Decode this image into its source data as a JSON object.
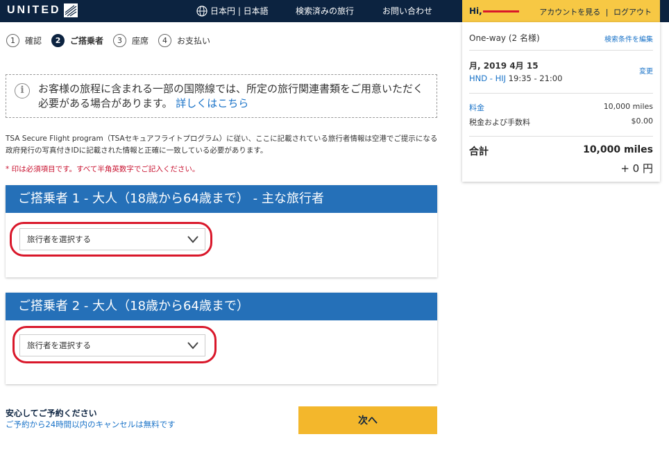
{
  "header": {
    "logo_text": "UNITED",
    "currency_language": "日本円 | 日本語",
    "searched_trips": "検索済みの旅行",
    "contact": "お問い合わせ"
  },
  "account": {
    "greeting": "Hi,",
    "view_account": "アカウントを見る",
    "separator": "|",
    "logout": "ログアウト"
  },
  "stepper": [
    {
      "num": "1",
      "label": "確認"
    },
    {
      "num": "2",
      "label": "ご搭乗者"
    },
    {
      "num": "3",
      "label": "座席"
    },
    {
      "num": "4",
      "label": "お支払い"
    }
  ],
  "notice": {
    "text": "お客様の旅程に含まれる一部の国際線では、所定の旅行関連書類をご用意いただく必要がある場合があります。",
    "link": "詳しくはこちら"
  },
  "tsa_text": "TSA Secure Flight program（TSAセキュアフライトプログラム）に従い、ここに記載されている旅行者情報は空港でご提示になる政府発行の写真付きIDに記載された情報と正確に一致している必要があります。",
  "required_note": "* 印は必須項目です。すべて半角英数字でご記入ください。",
  "passengers": [
    {
      "title": "ご搭乗者 1 - 大人（18歳から64歳まで） - 主な旅行者",
      "select_value": "旅行者を選択する"
    },
    {
      "title": "ご搭乗者 2 - 大人（18歳から64歳まで）",
      "select_value": "旅行者を選択する"
    }
  ],
  "assurance": {
    "title": "安心してご予約ください",
    "subtitle": "ご予約から24時間以内のキャンセルは無料です"
  },
  "next_button": "次へ",
  "summary": {
    "trip_type": "One-way (2 名様)",
    "edit_search": "検索条件を編集",
    "date": "月, 2019 4月 15",
    "change": "変更",
    "route_code": "HND - HIJ",
    "route_time": "19:35 - 21:00",
    "fare_label": "料金",
    "fare_value": "10,000 miles",
    "tax_label": "税金および手数料",
    "tax_value": "$0.00",
    "total_label": "合計",
    "total_miles": "10,000 miles",
    "total_yen": "+ 0 円"
  },
  "colors": {
    "nav_bg": "#0c2340",
    "account_yellow": "#f7c844",
    "card_header_blue": "#2570b8",
    "link_blue": "#1a73c8",
    "highlight_red": "#d9172a",
    "button_yellow": "#f3b72c"
  },
  "icons": {
    "globe": "globe-icon",
    "info": "info-icon",
    "chevron": "chevron-down-icon"
  }
}
